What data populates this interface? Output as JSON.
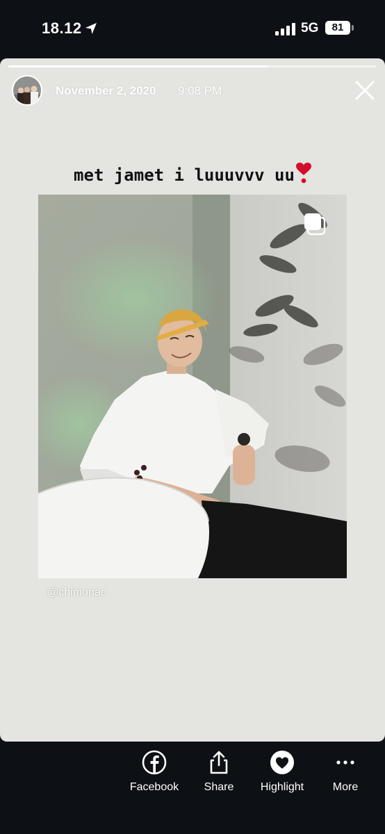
{
  "status_bar": {
    "time": "18.12",
    "network": "5G",
    "battery": "81",
    "icons": [
      "location-arrow-icon",
      "signal-bars-icon",
      "battery-icon"
    ]
  },
  "story": {
    "progress_fraction": 0.705,
    "date": "November 2, 2020",
    "time": "9:08 PM",
    "caption": "met jamet i luuuvvv uu",
    "credit": "@chimonac",
    "icons": [
      "close-icon",
      "heart-emoji-icon",
      "multiple-photos-icon"
    ]
  },
  "actions": [
    {
      "label": "Facebook",
      "icon": "facebook-icon"
    },
    {
      "label": "Share",
      "icon": "share-icon"
    },
    {
      "label": "Highlight",
      "icon": "highlight-heart-icon"
    },
    {
      "label": "More",
      "icon": "more-dots-icon"
    }
  ],
  "colors": {
    "background": "#0d1115",
    "story_background": "#e4e4e0",
    "heart": "#d2102a"
  }
}
